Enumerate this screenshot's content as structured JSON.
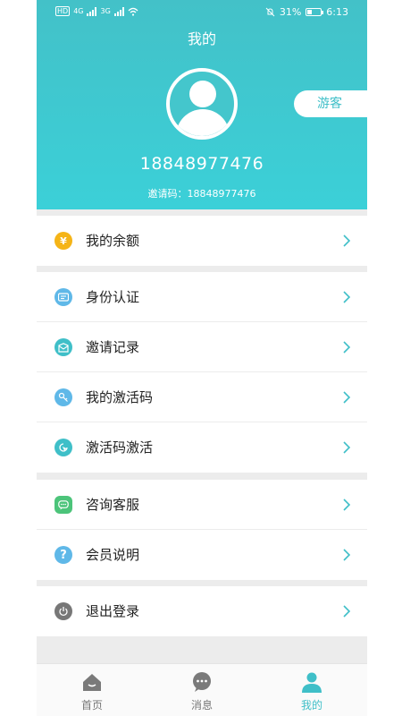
{
  "status_bar": {
    "network_badge": "HD",
    "net_1": "4G",
    "net_2": "3G",
    "battery": "31%",
    "time": "6:13"
  },
  "header": {
    "title": "我的",
    "guest_button": "游客",
    "phone": "18848977476",
    "invite_code": "邀请码：18848977476"
  },
  "menu_groups": [
    [
      {
        "label": "我的余额",
        "icon": "yen-icon",
        "color": "#f5b417"
      }
    ],
    [
      {
        "label": "身份认证",
        "icon": "id-card-icon",
        "color": "#5fb8e8"
      },
      {
        "label": "邀请记录",
        "icon": "invite-record-icon",
        "color": "#3fbfc8"
      },
      {
        "label": "我的激活码",
        "icon": "key-icon",
        "color": "#5fb8e8"
      },
      {
        "label": "激活码激活",
        "icon": "activate-icon",
        "color": "#3fbfc8"
      }
    ],
    [
      {
        "label": "咨询客服",
        "icon": "chat-icon",
        "color": "#4cc47a"
      },
      {
        "label": "会员说明",
        "icon": "question-icon",
        "color": "#5fb8e8"
      }
    ],
    [
      {
        "label": "退出登录",
        "icon": "power-icon",
        "color": "#777777"
      }
    ]
  ],
  "tabs": [
    {
      "label": "首页",
      "icon": "home-icon",
      "active": false
    },
    {
      "label": "消息",
      "icon": "message-icon",
      "active": false
    },
    {
      "label": "我的",
      "icon": "profile-icon",
      "active": true
    }
  ],
  "colors": {
    "accent": "#3fbfc8",
    "header_top": "#43c1c8",
    "header_bottom": "#3bd0d8",
    "divider": "#ececec"
  }
}
